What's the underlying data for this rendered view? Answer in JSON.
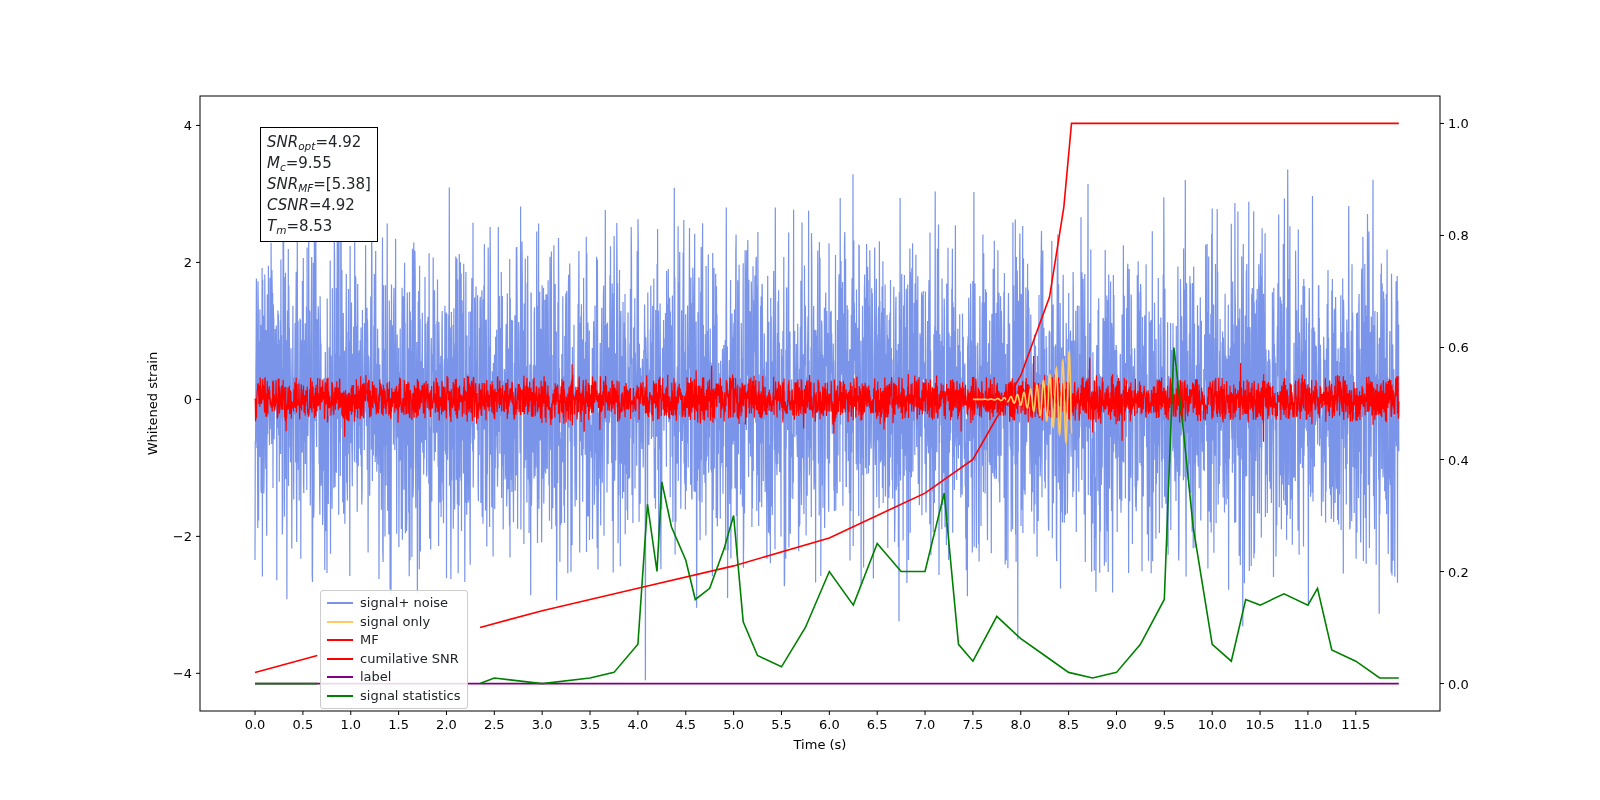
{
  "annotation": {
    "lines": [
      "*SNR*$_{opt}$=4.92",
      "*M*$_{c}$=9.55",
      "*SNR*$_{MF}$=[5.38]",
      "*CSNR*=4.92",
      "*T*$_{m}$=8.53"
    ]
  },
  "waveforms": [
    {
      "kind": "strain-noise",
      "label": "signal+ noise",
      "color": "#7994e8"
    },
    {
      "kind": "chirp",
      "label": "signal only",
      "color": "#ffc966"
    },
    {
      "kind": "filter-noise",
      "label": "MF",
      "color": "#ff0000"
    }
  ],
  "chart_data": {
    "type": "line",
    "xlabel": "Time (s)",
    "ylabel": "Whitened strain",
    "xlim": [
      -0.575,
      12.38
    ],
    "ylim": [
      -4.55,
      4.43
    ],
    "y2lim": [
      -0.049,
      1.049
    ],
    "xticks": [
      {
        "value": 0,
        "label": "0.0"
      },
      {
        "value": 0.5,
        "label": "0.5"
      },
      {
        "value": 1,
        "label": "1.0"
      },
      {
        "value": 1.5,
        "label": "1.5"
      },
      {
        "value": 2,
        "label": "2.0"
      },
      {
        "value": 2.5,
        "label": "2.5"
      },
      {
        "value": 3,
        "label": "3.0"
      },
      {
        "value": 3.5,
        "label": "3.5"
      },
      {
        "value": 4,
        "label": "4.0"
      },
      {
        "value": 4.5,
        "label": "4.5"
      },
      {
        "value": 5,
        "label": "5.0"
      },
      {
        "value": 5.5,
        "label": "5.5"
      },
      {
        "value": 6,
        "label": "6.0"
      },
      {
        "value": 6.5,
        "label": "6.5"
      },
      {
        "value": 7,
        "label": "7.0"
      },
      {
        "value": 7.5,
        "label": "7.5"
      },
      {
        "value": 8,
        "label": "8.0"
      },
      {
        "value": 8.5,
        "label": "8.5"
      },
      {
        "value": 9,
        "label": "9.0"
      },
      {
        "value": 9.5,
        "label": "9.5"
      },
      {
        "value": 10,
        "label": "10.0"
      },
      {
        "value": 10.5,
        "label": "10.5"
      },
      {
        "value": 11,
        "label": "11.0"
      },
      {
        "value": 11.5,
        "label": "11.5"
      }
    ],
    "yticks": [
      {
        "value": -4,
        "label": "−4"
      },
      {
        "value": -2,
        "label": "−2"
      },
      {
        "value": 0,
        "label": "0"
      },
      {
        "value": 2,
        "label": "2"
      },
      {
        "value": 4,
        "label": "4"
      }
    ],
    "y2ticks": [
      {
        "value": 0,
        "label": "0.0"
      },
      {
        "value": 0.2,
        "label": "0.2"
      },
      {
        "value": 0.4,
        "label": "0.4"
      },
      {
        "value": 0.6,
        "label": "0.6"
      },
      {
        "value": 0.8,
        "label": "0.8"
      },
      {
        "value": 1,
        "label": "1.0"
      }
    ],
    "series": [
      {
        "name": "cumilative SNR",
        "color": "#ff0000",
        "axis": "y2",
        "x": [
          0,
          0.65,
          1,
          2,
          2.35,
          3,
          4,
          5,
          6,
          7,
          7.5,
          8,
          8.3,
          8.45,
          8.53,
          11.95
        ],
        "values": [
          0.02,
          0.05,
          null,
          null,
          0.1,
          0.13,
          0.17,
          0.21,
          0.26,
          0.34,
          0.4,
          0.55,
          0.69,
          0.85,
          1.0,
          1.0
        ]
      },
      {
        "name": "label",
        "color": "#800080",
        "axis": "y2",
        "x": [
          0,
          11.95
        ],
        "values": [
          0,
          0
        ]
      },
      {
        "name": "signal statistics",
        "color": "#008000",
        "axis": "y2",
        "x": [
          0,
          0.5,
          0.65,
          1,
          1.5,
          2,
          2.35,
          2.5,
          3,
          3.5,
          3.75,
          4,
          4.1,
          4.2,
          4.25,
          4.35,
          4.5,
          4.6,
          4.75,
          4.9,
          5.0,
          5.1,
          5.25,
          5.5,
          5.75,
          6,
          6.25,
          6.5,
          6.75,
          7,
          7.2,
          7.35,
          7.5,
          7.75,
          8,
          8.25,
          8.5,
          8.75,
          9,
          9.25,
          9.5,
          9.6,
          9.7,
          9.8,
          10,
          10.2,
          10.35,
          10.5,
          10.75,
          11,
          11.1,
          11.25,
          11.5,
          11.75,
          11.95
        ],
        "values": [
          0,
          0,
          0,
          null,
          null,
          null,
          0,
          0.01,
          0,
          0.01,
          0.02,
          0.07,
          0.32,
          0.2,
          0.36,
          0.28,
          0.22,
          0.15,
          0.17,
          0.24,
          0.3,
          0.11,
          0.05,
          0.03,
          0.1,
          0.2,
          0.14,
          0.25,
          0.2,
          0.2,
          0.34,
          0.07,
          0.04,
          0.12,
          0.08,
          0.05,
          0.02,
          0.01,
          0.02,
          0.07,
          0.15,
          0.6,
          0.45,
          0.28,
          0.07,
          0.04,
          0.15,
          0.14,
          0.16,
          0.14,
          0.17,
          0.06,
          0.04,
          0.01,
          0.01
        ]
      }
    ]
  }
}
